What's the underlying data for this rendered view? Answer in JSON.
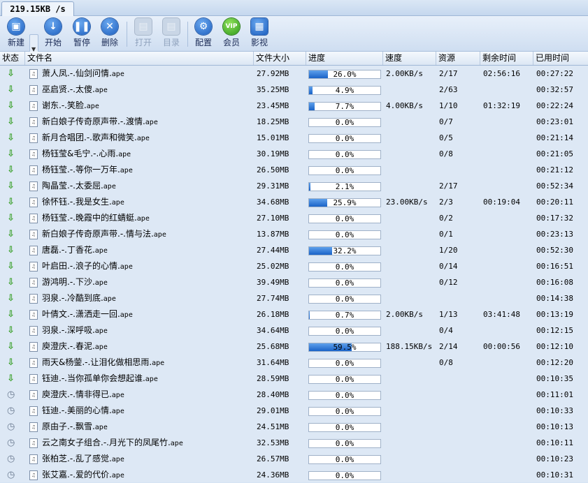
{
  "tab": {
    "speed": "219.15KB /s"
  },
  "toolbar": {
    "new": "新建",
    "start": "开始",
    "pause": "暂停",
    "delete": "删除",
    "open": "打开",
    "folder": "目录",
    "config": "配置",
    "member": "会员",
    "video": "影视",
    "vip_badge": "VIP"
  },
  "columns": {
    "status": "状态",
    "filename": "文件名",
    "size": "文件大小",
    "progress": "进度",
    "speed": "速度",
    "sources": "资源",
    "remaining": "剩余时间",
    "elapsed": "已用时间"
  },
  "colors": {
    "accent": "#1a63c7",
    "downloading": "#2f9b1c",
    "waiting": "#6a7a90",
    "background": "#dde8f5"
  },
  "rows": [
    {
      "status": "downloading",
      "name": "萧人凤.-.仙剑问情.",
      "ext": "ape",
      "size": "27.92MB",
      "progress": 26.0,
      "progress_text": "26.0%",
      "speed": "2.00KB/s",
      "sources": "2/17",
      "remaining": "02:56:16",
      "elapsed": "00:27:22"
    },
    {
      "status": "downloading",
      "name": "巫启贤.-.太傻.",
      "ext": "ape",
      "size": "35.25MB",
      "progress": 4.9,
      "progress_text": "4.9%",
      "speed": "",
      "sources": "2/63",
      "remaining": "",
      "elapsed": "00:32:57"
    },
    {
      "status": "downloading",
      "name": "谢东.-.笑脸.",
      "ext": "ape",
      "size": "23.45MB",
      "progress": 7.7,
      "progress_text": "7.7%",
      "speed": "4.00KB/s",
      "sources": "1/10",
      "remaining": "01:32:19",
      "elapsed": "00:22:24"
    },
    {
      "status": "downloading",
      "name": "新白娘子传奇原声带.-.渡情.",
      "ext": "ape",
      "size": "18.25MB",
      "progress": 0,
      "progress_text": "0.0%",
      "speed": "",
      "sources": "0/7",
      "remaining": "",
      "elapsed": "00:23:01"
    },
    {
      "status": "downloading",
      "name": "新月合唱团.-.歌声和微笑.",
      "ext": "ape",
      "size": "15.01MB",
      "progress": 0,
      "progress_text": "0.0%",
      "speed": "",
      "sources": "0/5",
      "remaining": "",
      "elapsed": "00:21:14"
    },
    {
      "status": "downloading",
      "name": "杨钰莹&毛宁.-.心雨.",
      "ext": "ape",
      "size": "30.19MB",
      "progress": 0,
      "progress_text": "0.0%",
      "speed": "",
      "sources": "0/8",
      "remaining": "",
      "elapsed": "00:21:05"
    },
    {
      "status": "downloading",
      "name": "杨钰莹.-.等你一万年.",
      "ext": "ape",
      "size": "26.50MB",
      "progress": 0,
      "progress_text": "0.0%",
      "speed": "",
      "sources": "",
      "remaining": "",
      "elapsed": "00:21:12"
    },
    {
      "status": "downloading",
      "name": "陶晶莹.-.太委屈.",
      "ext": "ape",
      "size": "29.31MB",
      "progress": 2.1,
      "progress_text": "2.1%",
      "speed": "",
      "sources": "2/17",
      "remaining": "",
      "elapsed": "00:52:34"
    },
    {
      "status": "downloading",
      "name": "徐怀钰.-.我是女生.",
      "ext": "ape",
      "size": "34.68MB",
      "progress": 25.9,
      "progress_text": "25.9%",
      "speed": "23.00KB/s",
      "sources": "2/3",
      "remaining": "00:19:04",
      "elapsed": "00:20:11"
    },
    {
      "status": "downloading",
      "name": "杨钰莹.-.晚霞中的红蜻蜓.",
      "ext": "ape",
      "size": "27.10MB",
      "progress": 0,
      "progress_text": "0.0%",
      "speed": "",
      "sources": "0/2",
      "remaining": "",
      "elapsed": "00:17:32"
    },
    {
      "status": "downloading",
      "name": "新白娘子传奇原声带.-.情与法.",
      "ext": "ape",
      "size": "13.87MB",
      "progress": 0,
      "progress_text": "0.0%",
      "speed": "",
      "sources": "0/1",
      "remaining": "",
      "elapsed": "00:23:13"
    },
    {
      "status": "downloading",
      "name": "唐磊.-.丁香花.",
      "ext": "ape",
      "size": "27.44MB",
      "progress": 32.2,
      "progress_text": "32.2%",
      "speed": "",
      "sources": "1/20",
      "remaining": "",
      "elapsed": "00:52:30"
    },
    {
      "status": "downloading",
      "name": "叶启田.-.浪子的心情.",
      "ext": "ape",
      "size": "25.02MB",
      "progress": 0,
      "progress_text": "0.0%",
      "speed": "",
      "sources": "0/14",
      "remaining": "",
      "elapsed": "00:16:51"
    },
    {
      "status": "downloading",
      "name": "游鸿明.-.下沙.",
      "ext": "ape",
      "size": "39.49MB",
      "progress": 0,
      "progress_text": "0.0%",
      "speed": "",
      "sources": "0/12",
      "remaining": "",
      "elapsed": "00:16:08"
    },
    {
      "status": "downloading",
      "name": "羽泉.-.冷酷到底.",
      "ext": "ape",
      "size": "27.74MB",
      "progress": 0,
      "progress_text": "0.0%",
      "speed": "",
      "sources": "",
      "remaining": "",
      "elapsed": "00:14:38"
    },
    {
      "status": "downloading",
      "name": "叶倩文.-.潇洒走一回.",
      "ext": "ape",
      "size": "26.18MB",
      "progress": 0.7,
      "progress_text": "0.7%",
      "speed": "2.00KB/s",
      "sources": "1/13",
      "remaining": "03:41:48",
      "elapsed": "00:13:19"
    },
    {
      "status": "downloading",
      "name": "羽泉.-.深呼吸.",
      "ext": "ape",
      "size": "34.64MB",
      "progress": 0,
      "progress_text": "0.0%",
      "speed": "",
      "sources": "0/4",
      "remaining": "",
      "elapsed": "00:12:15"
    },
    {
      "status": "downloading",
      "name": "庾澄庆.-.春泥.",
      "ext": "ape",
      "size": "25.68MB",
      "progress": 59.5,
      "progress_text": "59.5%",
      "speed": "188.15KB/s",
      "sources": "2/14",
      "remaining": "00:00:56",
      "elapsed": "00:12:10"
    },
    {
      "status": "downloading",
      "name": "雨天&杨蓥.-.让泪化做相思雨.",
      "ext": "ape",
      "size": "31.64MB",
      "progress": 0,
      "progress_text": "0.0%",
      "speed": "",
      "sources": "0/8",
      "remaining": "",
      "elapsed": "00:12:20"
    },
    {
      "status": "downloading",
      "name": "钰迪.-.当你孤单你会想起谁.",
      "ext": "ape",
      "size": "28.59MB",
      "progress": 0,
      "progress_text": "0.0%",
      "speed": "",
      "sources": "",
      "remaining": "",
      "elapsed": "00:10:35"
    },
    {
      "status": "waiting",
      "name": "庾澄庆.-.情非得已.",
      "ext": "ape",
      "size": "28.40MB",
      "progress": 0,
      "progress_text": "0.0%",
      "speed": "",
      "sources": "",
      "remaining": "",
      "elapsed": "00:11:01"
    },
    {
      "status": "waiting",
      "name": "钰迪.-.美丽的心情.",
      "ext": "ape",
      "size": "29.01MB",
      "progress": 0,
      "progress_text": "0.0%",
      "speed": "",
      "sources": "",
      "remaining": "",
      "elapsed": "00:10:33"
    },
    {
      "status": "waiting",
      "name": "原由子.-.飘雪.",
      "ext": "ape",
      "size": "24.51MB",
      "progress": 0,
      "progress_text": "0.0%",
      "speed": "",
      "sources": "",
      "remaining": "",
      "elapsed": "00:10:13"
    },
    {
      "status": "waiting",
      "name": "云之南女子组合.-.月光下的凤尾竹.",
      "ext": "ape",
      "size": "32.53MB",
      "progress": 0,
      "progress_text": "0.0%",
      "speed": "",
      "sources": "",
      "remaining": "",
      "elapsed": "00:10:11"
    },
    {
      "status": "waiting",
      "name": "张柏芝.-.乱了感觉.",
      "ext": "ape",
      "size": "26.57MB",
      "progress": 0,
      "progress_text": "0.0%",
      "speed": "",
      "sources": "",
      "remaining": "",
      "elapsed": "00:10:23"
    },
    {
      "status": "waiting",
      "name": "张艾嘉.-.爱的代价.",
      "ext": "ape",
      "size": "24.36MB",
      "progress": 0,
      "progress_text": "0.0%",
      "speed": "",
      "sources": "",
      "remaining": "",
      "elapsed": "00:10:31"
    }
  ]
}
